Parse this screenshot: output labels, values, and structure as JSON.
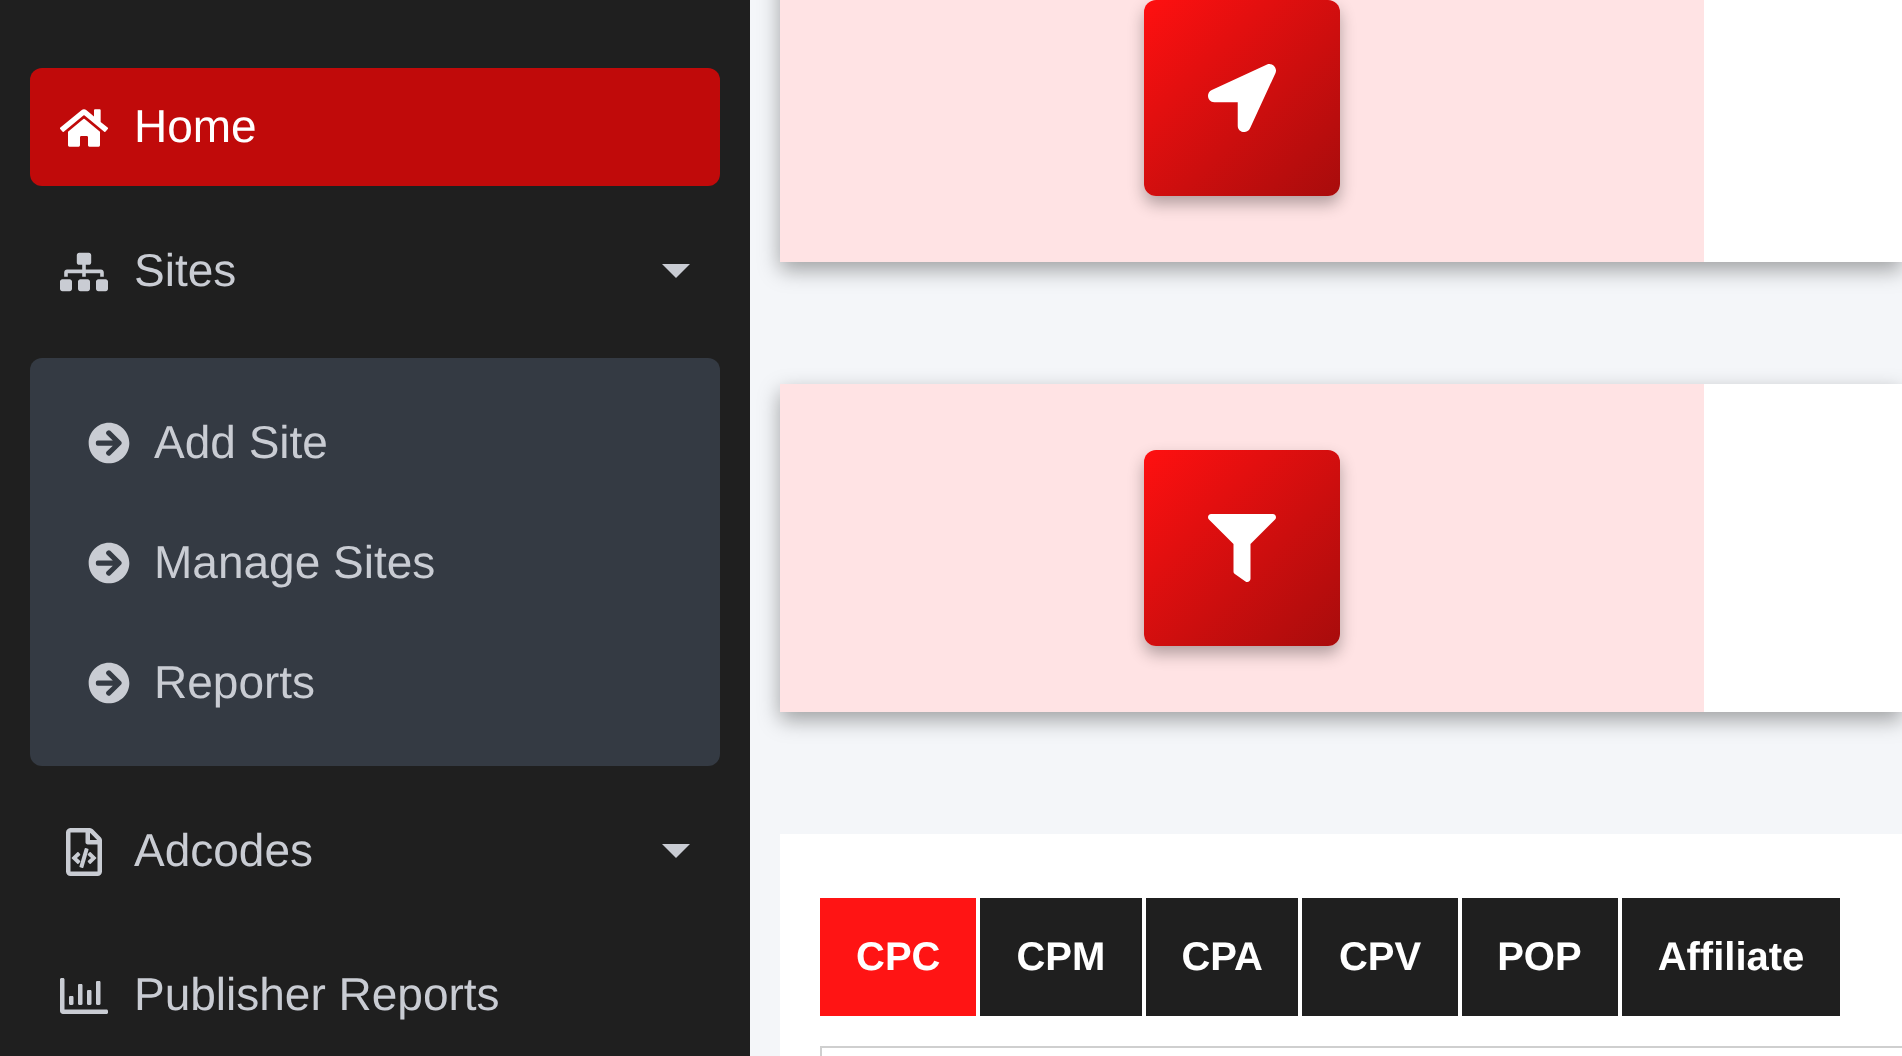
{
  "sidebar": {
    "items": [
      {
        "label": "Home",
        "kind": "link",
        "selected": true
      },
      {
        "label": "Sites",
        "kind": "dropdown",
        "selected": false,
        "expanded": true,
        "children": [
          {
            "label": "Add Site"
          },
          {
            "label": "Manage Sites"
          },
          {
            "label": "Reports"
          }
        ]
      },
      {
        "label": "Adcodes",
        "kind": "dropdown",
        "selected": false
      },
      {
        "label": "Publisher Reports",
        "kind": "link",
        "selected": false
      }
    ]
  },
  "tabs": [
    {
      "label": "CPC",
      "selected": true
    },
    {
      "label": "CPM",
      "selected": false
    },
    {
      "label": "CPA",
      "selected": false
    },
    {
      "label": "CPV",
      "selected": false
    },
    {
      "label": "POP",
      "selected": false
    },
    {
      "label": "Affiliate",
      "selected": false
    }
  ]
}
